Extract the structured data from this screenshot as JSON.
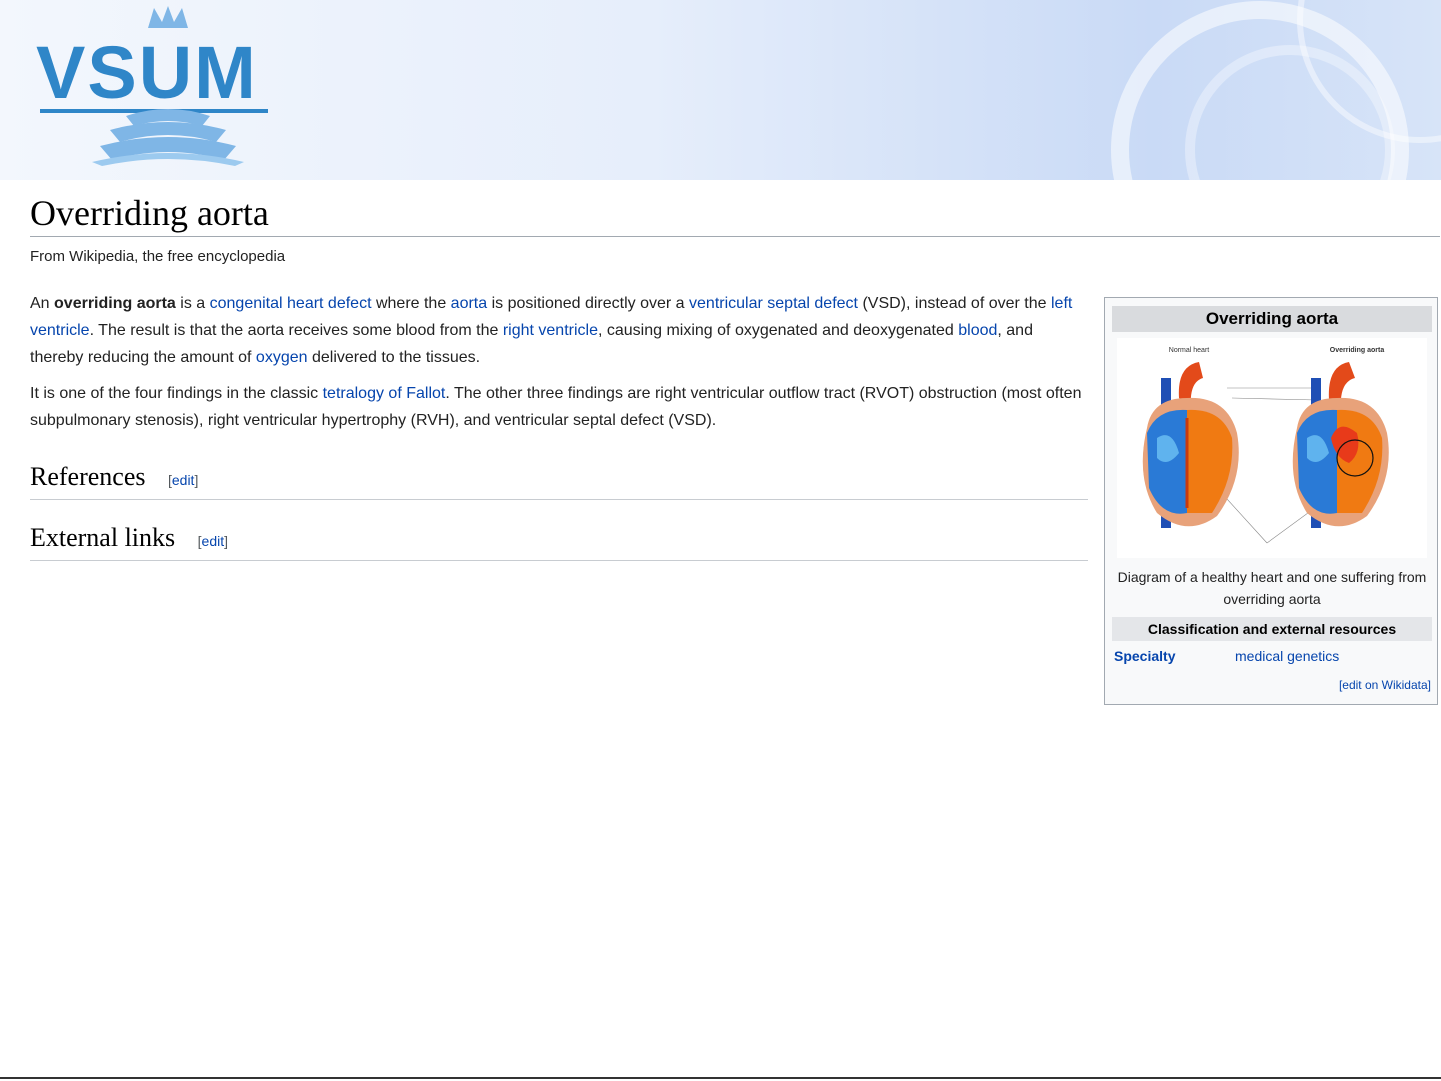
{
  "banner": {
    "logo_text": "VSUM",
    "colors": {
      "logo": "#2f86c8",
      "logo_light": "#7fb6e6"
    }
  },
  "article": {
    "title": "Overriding aorta",
    "tagline": "From Wikipedia, the free encyclopedia",
    "p1": {
      "t1": "An ",
      "b1": "overriding aorta",
      "t2": " is a ",
      "l1": "congenital heart defect",
      "t3": " where the ",
      "l2": "aorta",
      "t4": " is positioned directly over a ",
      "l3": "ventricular septal defect",
      "t5": " (VSD), instead of over the ",
      "l4": "left ventricle",
      "t6": ". The result is that the aorta receives some blood from the ",
      "l5": "right ventricle",
      "t7": ", causing mixing of oxygenated and deoxygenated ",
      "l6": "blood",
      "t8": ", and thereby reducing the amount of ",
      "l7": "oxygen",
      "t9": " delivered to the tissues."
    },
    "p2": {
      "t1": "It is one of the four findings in the classic ",
      "l1": "tetralogy of Fallot",
      "t2": ". The other three findings are right ventricular outflow tract (RVOT) obstruction (most often subpulmonary stenosis), right ventricular hypertrophy (RVH), and ventricular septal defect (VSD)."
    },
    "sections": [
      {
        "heading": "References",
        "edit_open": "[",
        "edit_label": "edit",
        "edit_close": "]"
      },
      {
        "heading": "External links",
        "edit_open": "[",
        "edit_label": "edit",
        "edit_close": "]"
      }
    ],
    "link_color": "#0645ad"
  },
  "infobox": {
    "title": "Overriding aorta",
    "image_labels": {
      "left": "Normal heart",
      "right": "Overriding aorta"
    },
    "caption": "Diagram of a healthy heart and one suffering from overriding aorta",
    "subheader": "Classification and external resources",
    "row_label": "Specialty",
    "row_value": "medical genetics",
    "wikidata_link": "[edit on Wikidata]"
  }
}
